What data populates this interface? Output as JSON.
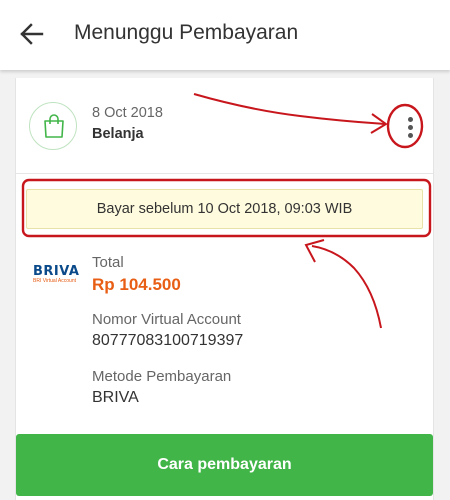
{
  "appbar": {
    "title": "Menunggu Pembayaran"
  },
  "order": {
    "date": "8 Oct 2018",
    "type": "Belanja"
  },
  "deadline": {
    "text": "Bayar sebelum 10 Oct 2018, 09:03 WIB"
  },
  "payment": {
    "logo_text": "BRIVA",
    "logo_subtext": "BRI Virtual Account",
    "total_label": "Total",
    "total_value": "Rp 104.500",
    "va_label": "Nomor Virtual Account",
    "va_value": "80777083100719397",
    "method_label": "Metode Pembayaran",
    "method_value": "BRIVA"
  },
  "button": {
    "label": "Cara pembayaran"
  },
  "colors": {
    "accent_green": "#42b549",
    "total_orange": "#e85e14",
    "annotation_red": "#c8161d"
  }
}
